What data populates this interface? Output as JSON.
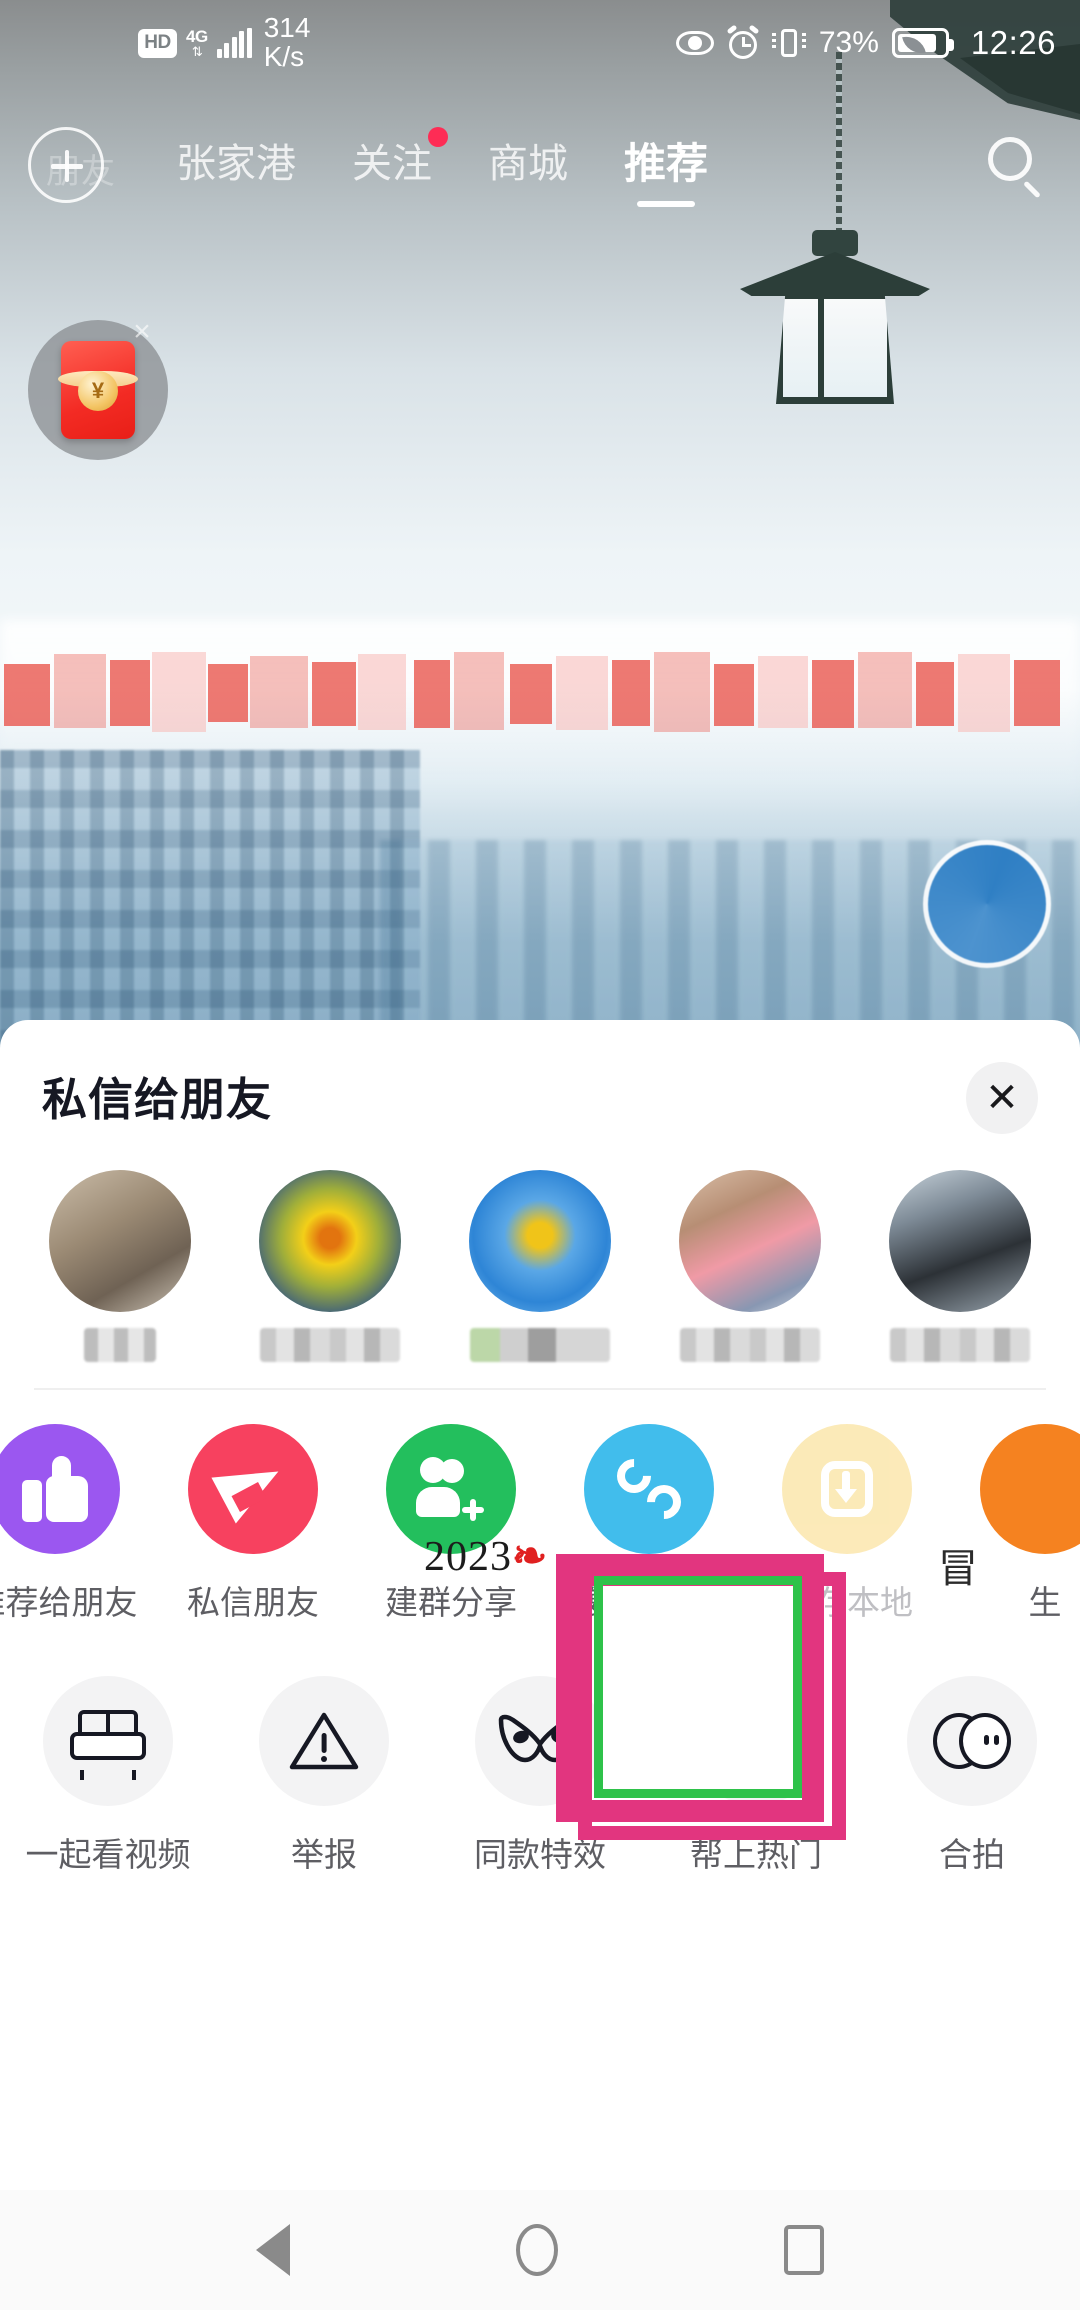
{
  "status_bar": {
    "hd_badge": "HD",
    "network": "4G",
    "speed_value": "314",
    "speed_unit": "K/s",
    "battery_percent": "73%",
    "time": "12:26",
    "icons": [
      "eye-care-icon",
      "alarm-icon",
      "vibrate-icon",
      "battery-icon"
    ]
  },
  "top_nav": {
    "add_button": "add-icon",
    "ghost_label": "朋友",
    "tabs": [
      {
        "label": "张家港",
        "active": false,
        "dot": false
      },
      {
        "label": "关注",
        "active": false,
        "dot": true
      },
      {
        "label": "商城",
        "active": false,
        "dot": false
      },
      {
        "label": "推荐",
        "active": true,
        "dot": false
      }
    ],
    "search": "search-icon"
  },
  "red_packet": {
    "currency_symbol": "¥",
    "close": "×"
  },
  "share_sheet": {
    "title": "私信给朋友",
    "close_label": "✕",
    "friends": [
      {
        "name": "帀"
      },
      {
        "name": ""
      },
      {
        "name": ""
      },
      {
        "name": ""
      },
      {
        "name": ""
      }
    ],
    "video_overlay_year": "2023",
    "video_overlay_char": "冒",
    "actions_row1": [
      {
        "label": "推荐给朋友",
        "icon": "thumbs-up-icon",
        "color": "#9b57f0",
        "dim": false
      },
      {
        "label": "私信朋友",
        "icon": "paper-plane-icon",
        "color": "#f7415f",
        "dim": false
      },
      {
        "label": "建群分享",
        "icon": "add-group-icon",
        "color": "#23bf5d",
        "dim": false
      },
      {
        "label": "复制链接",
        "icon": "link-icon",
        "color": "#41bdec",
        "dim": false
      },
      {
        "label": "保存本地",
        "icon": "download-icon",
        "color": "#f7c948",
        "dim": true
      },
      {
        "label": "生",
        "icon": "generate-icon",
        "color": "#f58220",
        "dim": false
      }
    ],
    "actions_row2": [
      {
        "label": "一起看视频",
        "icon": "sofa-icon"
      },
      {
        "label": "举报",
        "icon": "warning-icon"
      },
      {
        "label": "同款特效",
        "icon": "mask-icon"
      },
      {
        "label": "帮上热门",
        "icon": "dou-plus-icon"
      },
      {
        "label": "合拍",
        "icon": "duet-icon"
      }
    ]
  },
  "highlight": {
    "target_label": "复制链接",
    "outer_color": "#e2357f",
    "inner_color": "#2ec24a"
  },
  "system_nav": {
    "back": "back-triangle-icon",
    "home": "home-circle-icon",
    "recents": "recents-square-icon"
  }
}
